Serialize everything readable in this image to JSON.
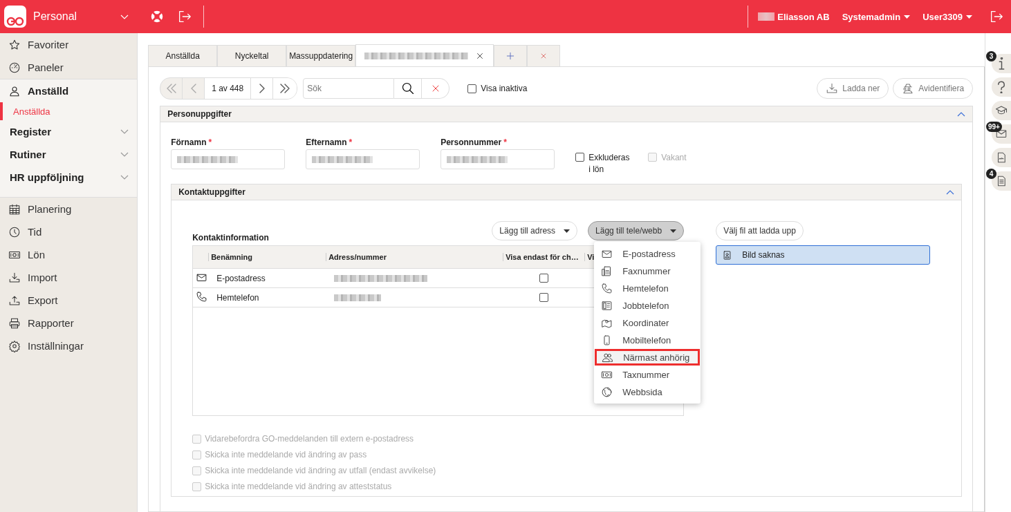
{
  "header": {
    "app_name": "Personal",
    "company": "Eliasson AB",
    "role": "Systemadmin",
    "user": "User3309"
  },
  "sidebar": {
    "top_items": [
      {
        "label": "Favoriter"
      },
      {
        "label": "Paneler"
      }
    ],
    "section": {
      "label": "Anställd",
      "children": [
        {
          "label": "Anställda",
          "selected": true
        }
      ]
    },
    "groups": [
      {
        "label": "Register",
        "expanded": false
      },
      {
        "label": "Rutiner",
        "expanded": false
      },
      {
        "label": "HR uppföljning",
        "expanded": false
      }
    ],
    "items": [
      {
        "label": "Planering"
      },
      {
        "label": "Tid"
      },
      {
        "label": "Lön"
      },
      {
        "label": "Import"
      },
      {
        "label": "Export"
      },
      {
        "label": "Rapporter"
      },
      {
        "label": "Inställningar"
      }
    ]
  },
  "tabs": [
    {
      "label": "Anställda",
      "selected": false
    },
    {
      "label": "Nyckeltal",
      "selected": false
    },
    {
      "label": "Massuppdatering",
      "selected": false
    },
    {
      "selected": true
    }
  ],
  "toolbar": {
    "pager": "1 av 448",
    "search": {
      "placeholder": "Sök"
    },
    "show_inactive": {
      "label": "Visa inaktiva",
      "checked": false
    },
    "buttons": [
      "Ladda ner",
      "Avidentifiera"
    ]
  },
  "person": {
    "title": "Personuppgifter",
    "expanded": true,
    "fields": [
      {
        "label": "Förnamn",
        "required_mark": "*"
      },
      {
        "label": "Efternamn",
        "required_mark": "*"
      },
      {
        "label": "Personnummer",
        "required_mark": "*"
      }
    ],
    "checkboxes": [
      {
        "label": "Exkluderas i lön",
        "checked": false,
        "disabled": false
      },
      {
        "label": "Vakant",
        "checked": false,
        "disabled": true
      }
    ]
  },
  "contacts": {
    "title": "Kontaktuppgifter",
    "expanded": true,
    "add_address": "Lägg till adress",
    "add_phone": {
      "label": "Lägg till tele/webb",
      "expanded": true
    },
    "menu": [
      {
        "kind": "email",
        "label": "E-postadress",
        "selected": false
      },
      {
        "kind": "fax",
        "label": "Faxnummer",
        "selected": false
      },
      {
        "kind": "phone",
        "label": "Hemtelefon",
        "selected": false
      },
      {
        "kind": "work",
        "label": "Jobbtelefon",
        "selected": false
      },
      {
        "kind": "map",
        "label": "Koordinater",
        "selected": false
      },
      {
        "kind": "mobile",
        "label": "Mobiltelefon",
        "selected": false
      },
      {
        "kind": "people",
        "label": "Närmast anhörig",
        "selected": true
      },
      {
        "kind": "money",
        "label": "Taxnummer",
        "selected": false
      },
      {
        "kind": "web",
        "label": "Webbsida",
        "selected": false
      }
    ],
    "table": {
      "title": "Kontaktinformation",
      "columns": [
        "Benämning",
        "Adress/nummer",
        "Visa endast för ch…",
        "Vi"
      ],
      "rows": [
        {
          "kind": "email",
          "name": "E-postadress",
          "checked": false
        },
        {
          "kind": "phone",
          "name": "Hemtelefon",
          "checked": false
        }
      ]
    },
    "upload": "Välj fil att ladda upp",
    "image_status": "Bild saknas",
    "options": [
      {
        "label": "Vidarebefordra GO-meddelanden till extern e-postadress",
        "checked": false,
        "disabled": true
      },
      {
        "label": "Skicka inte meddelande vid ändring av pass",
        "checked": false,
        "disabled": true
      },
      {
        "label": "Skicka inte meddelande vid ändring av utfall (endast avvikelse)",
        "checked": false,
        "disabled": true
      },
      {
        "label": "Skicka inte meddelande vid ändring av atteststatus",
        "checked": false,
        "disabled": true
      }
    ]
  },
  "rail": [
    {
      "kind": "info",
      "badge": "3"
    },
    {
      "kind": "help"
    },
    {
      "kind": "course"
    },
    {
      "kind": "message",
      "badge": "99+"
    },
    {
      "kind": "signed"
    },
    {
      "kind": "document",
      "badge": "4"
    }
  ]
}
